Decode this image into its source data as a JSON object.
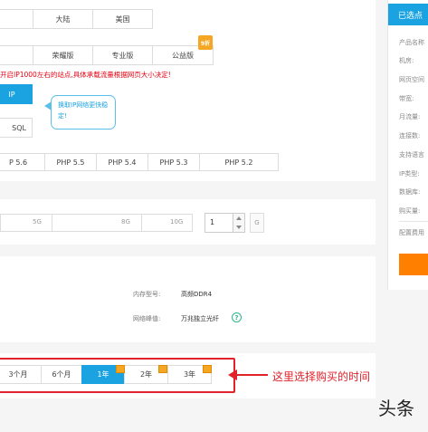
{
  "region": {
    "options": [
      "",
      "大陆",
      "美国"
    ]
  },
  "edition": {
    "options": [
      "",
      "荣耀版",
      "专业版",
      "公益版"
    ],
    "badge": "9折"
  },
  "notice": {
    "text": "开启IP1000左右的站点,具体承载流量根据网页大小决定!"
  },
  "ip": {
    "button_label": "IP",
    "tooltip": "换取IP网络更快稳定!"
  },
  "db": {
    "option_label": "SQL"
  },
  "php": {
    "options": [
      "P 5.6",
      "PHP 5.5",
      "PHP 5.4",
      "PHP 5.3",
      "PHP 5.2"
    ]
  },
  "disk": {
    "ticks": [
      "5G",
      "8G",
      "10G"
    ],
    "quantity": "1",
    "unit": "G"
  },
  "spec": {
    "memory_label": "内存型号:",
    "memory_value": "高频DDR4",
    "bandwidth_label": "网络峰值:",
    "bandwidth_value": "万兆独立光纤",
    "help_icon": "?"
  },
  "duration": {
    "options": [
      "3个月",
      "6个月",
      "1年",
      "2年",
      "3年"
    ],
    "selected_index": 2
  },
  "annotation": {
    "text": "这里选择购买的时间"
  },
  "sidebar": {
    "title": "已选点",
    "rows": [
      "产品名称",
      "机房:",
      "网页空间",
      "带宽:",
      "月流量:",
      "连接数:",
      "支持语言",
      "IP类型:",
      "数据库:",
      "购买量:"
    ],
    "footer": "配置费用"
  },
  "watermark": {
    "text": "头条"
  },
  "colors": {
    "accent": "#1aa3e0",
    "red": "#e60012",
    "orange": "#ff7f00",
    "badge": "#f5a623"
  }
}
